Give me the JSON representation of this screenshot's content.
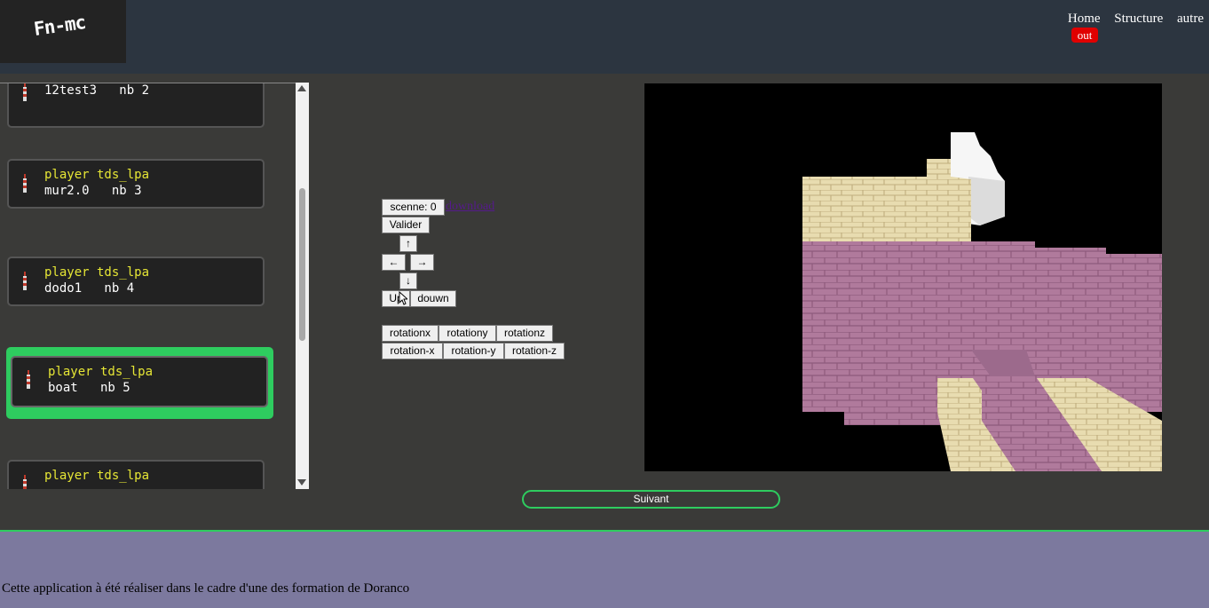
{
  "header": {
    "logo_text": "Fn-mc",
    "nav": [
      "Home",
      "Structure",
      "autre"
    ],
    "out_label": "out"
  },
  "scene_list": {
    "items": [
      {
        "line1": "",
        "line2": "12test3   nb 2"
      },
      {
        "line1": "player tds_lpa",
        "line2": "mur2.0   nb 3"
      },
      {
        "line1": "player tds_lpa",
        "line2": "dodo1   nb 4"
      },
      {
        "line1": "player tds_lpa",
        "line2": "boat   nb 5",
        "selected": true
      },
      {
        "line1": "player tds_lpa",
        "line2": ""
      }
    ]
  },
  "controls": {
    "scene_label": "scenne: 0",
    "download_label": "download",
    "validate_label": "Valider",
    "up_arrow": "↑",
    "left_arrow": "←",
    "right_arrow": "→",
    "down_arrow": "↓",
    "up_label": "Up",
    "down_label": "douwn",
    "rotations": [
      "rotationx",
      "rotationy",
      "rotationz"
    ],
    "rotations_neg": [
      "rotation-x",
      "rotation-y",
      "rotation-z"
    ]
  },
  "next_label": "Suivant",
  "footer_text": "Cette application à été réaliser dans le cadre d'une des formation de Doranco",
  "colors": {
    "header_bg": "#2c3540",
    "body_bg": "#3a3a38",
    "accent_green": "#2ecc5f",
    "out_red": "#e00000",
    "footer_bg": "#7c799e",
    "player_yellow": "#e6e635"
  }
}
